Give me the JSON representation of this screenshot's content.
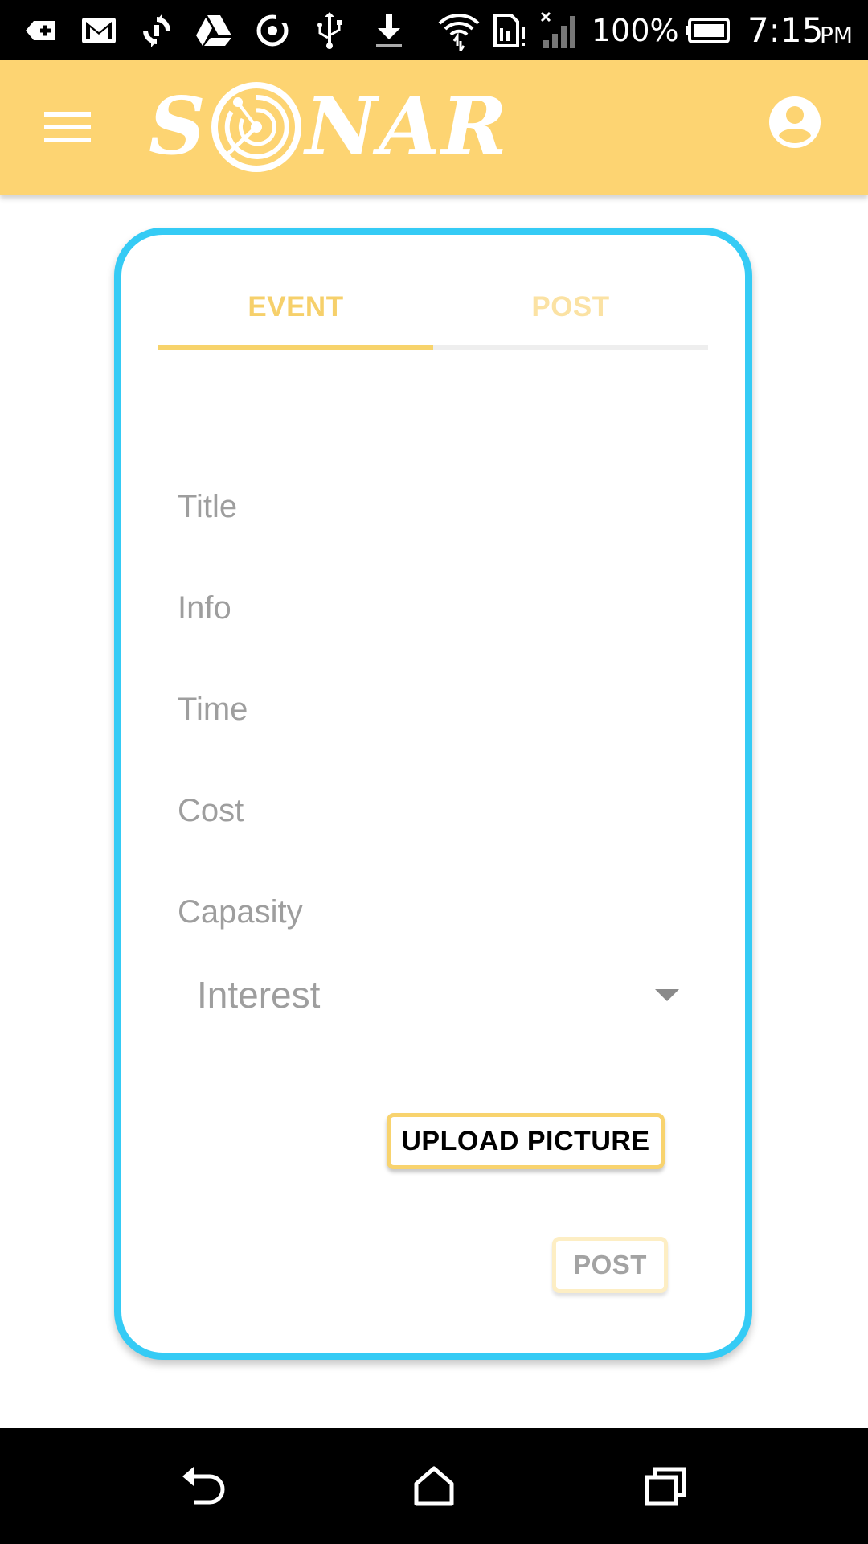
{
  "status_bar": {
    "battery_percent": "100%",
    "time": "7:15",
    "ampm": "PM",
    "icons": [
      "add-box-icon",
      "gmail-icon",
      "sync-icon",
      "drive-icon",
      "loading-circle-icon",
      "usb-icon",
      "download-icon",
      "wifi-icon",
      "sim-icon",
      "signal-icon",
      "battery-icon"
    ]
  },
  "app_bar": {
    "logo_text": [
      "S",
      "NAR"
    ],
    "menu_icon": "hamburger-menu-icon",
    "account_icon": "account-circle-icon",
    "background_color": "#fdd472"
  },
  "tabs": [
    {
      "label": "EVENT",
      "active": true
    },
    {
      "label": "POST",
      "active": false
    }
  ],
  "form": {
    "fields": [
      {
        "placeholder": "Title"
      },
      {
        "placeholder": "Info"
      },
      {
        "placeholder": "Time"
      },
      {
        "placeholder": "Cost"
      },
      {
        "placeholder": "Capasity"
      }
    ],
    "interest_select": {
      "value": "Interest"
    },
    "upload_button_label": "UPLOAD PICTURE",
    "post_button_label": "POST"
  },
  "colors": {
    "accent_yellow": "#fdd472",
    "card_border": "#35cbf5",
    "placeholder_gray": "#9e9e9e"
  },
  "nav_bar": {
    "icons": [
      "back-icon",
      "home-icon",
      "recents-icon"
    ]
  }
}
